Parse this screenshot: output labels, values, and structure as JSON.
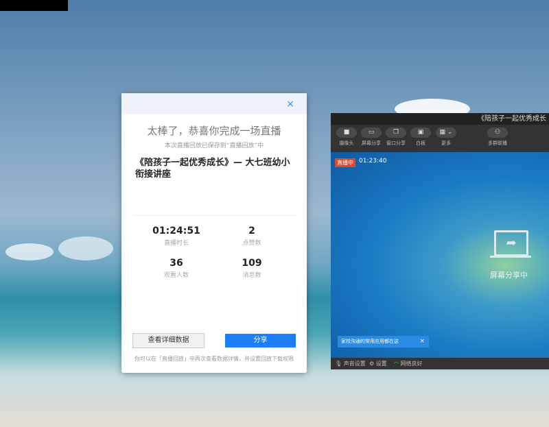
{
  "dialog": {
    "title": "太棒了，恭喜你完成一场直播",
    "subtitle": "本次直播回放已保存到“直播回放”中",
    "lesson_title": "《陪孩子一起优秀成长》— 大七班幼小衔接讲座",
    "close": "×",
    "stats": [
      {
        "value": "01:24:51",
        "label": "直播时长"
      },
      {
        "value": "2",
        "label": "点赞数"
      },
      {
        "value": "36",
        "label": "观看人数"
      },
      {
        "value": "109",
        "label": "消息数"
      }
    ],
    "detail_button": "查看详细数据",
    "share_button": "分享",
    "footer": "你可以在「直播回放」中再次查看数据详情，并设置回放下载权限"
  },
  "live_window": {
    "title": "《陪孩子一起优秀成长",
    "toolbar": [
      {
        "icon": "camera-icon",
        "glyph": "■",
        "label": "摄像头"
      },
      {
        "icon": "screen-share-icon",
        "glyph": "▭",
        "label": "屏幕分享"
      },
      {
        "icon": "window-share-icon",
        "glyph": "❐",
        "label": "窗口分享"
      },
      {
        "icon": "whiteboard-icon",
        "glyph": "▣",
        "label": "白板"
      },
      {
        "icon": "more-icon",
        "glyph": "▦ ⌄",
        "label": "更多"
      },
      {
        "icon": "multi-stream-icon",
        "glyph": "⚇",
        "label": "多群联播"
      }
    ],
    "live_badge": "直播中",
    "live_time": "01:23:40",
    "screen_share_label": "屏幕分享中",
    "tip": "家校沟通的常用应用都在这",
    "tip_close": "×",
    "status": {
      "audio": "声音设置",
      "settings": "设置",
      "network": "网络良好"
    }
  }
}
